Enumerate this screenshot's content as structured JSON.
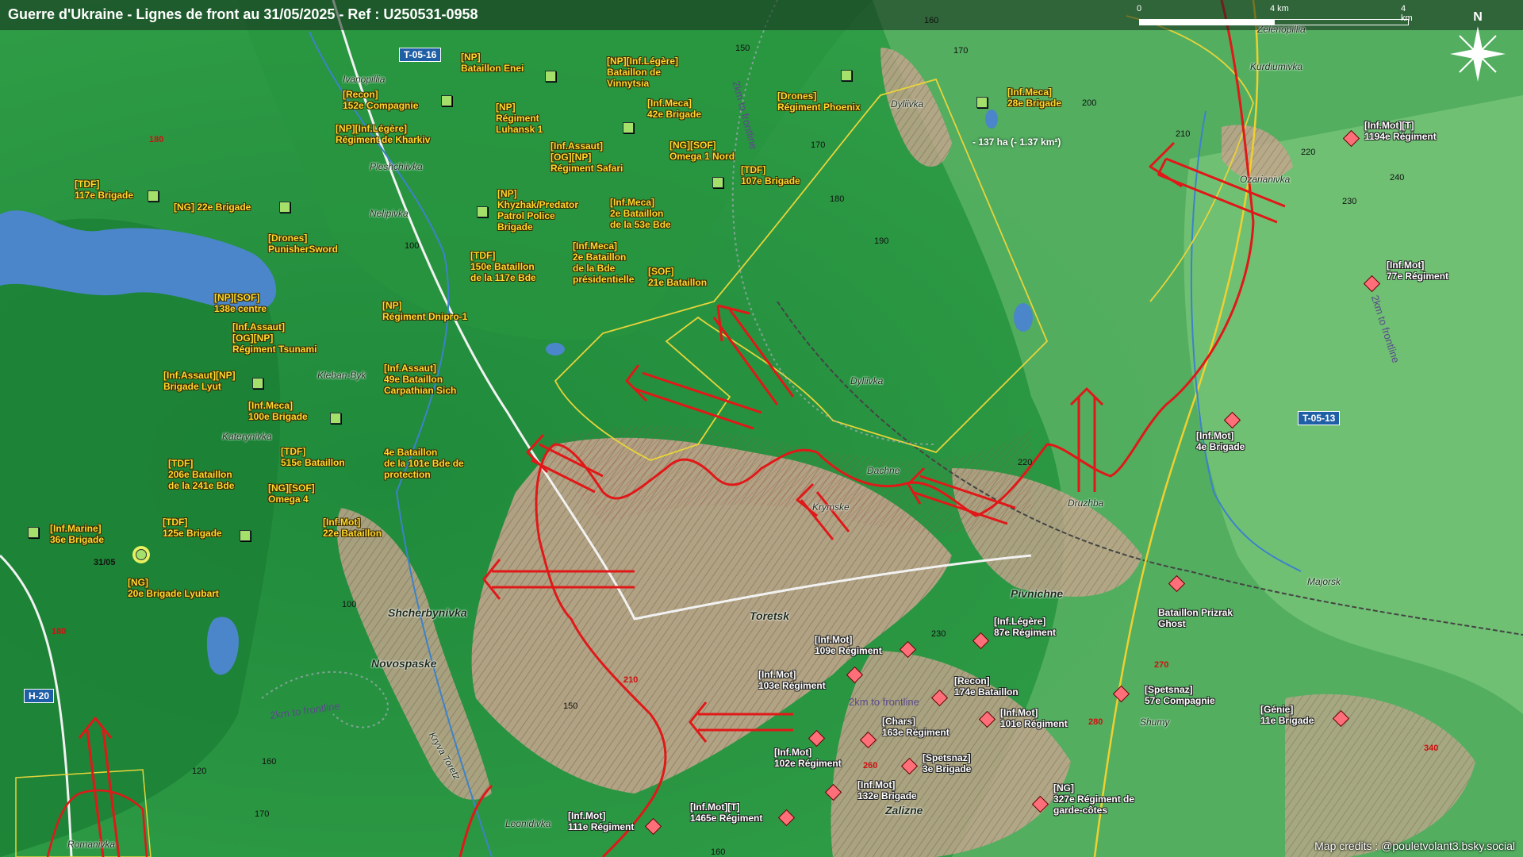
{
  "title": "Guerre d'Ukraine - Lignes de front au 31/05/2025 - Ref : U250531-0958",
  "scale": {
    "t0": "0",
    "t1": "2",
    "t2": "4 km"
  },
  "north_label": "N",
  "credits": "Map credits : @pouletvolant3.bsky.social",
  "area_note": "- 137 ha (- 1.37 km²)",
  "date_mark": "31/05",
  "colors": {
    "front": "#e01818",
    "ua_unit_text": "#ffd92e",
    "ru_unit_fill": "#ff6f7a",
    "road_badge": "#1f5fa6"
  },
  "roads": [
    "T-05-16",
    "T-05-13",
    "H-20"
  ],
  "route_labels": [
    "2km to frontline",
    "2km to frontline",
    "2km to frontline",
    "2km to frontline"
  ],
  "elevations": [
    "150",
    "160",
    "170",
    "180",
    "190",
    "200",
    "210",
    "220",
    "230",
    "240",
    "180",
    "180",
    "150",
    "160",
    "170",
    "160",
    "120",
    "230",
    "270",
    "280",
    "340",
    "260",
    "210",
    "100",
    "100",
    "220",
    "210",
    "160",
    "170",
    "180"
  ],
  "places": [
    {
      "name": "Ivanopillia",
      "big": false
    },
    {
      "name": "Pleshchiivka",
      "big": false
    },
    {
      "name": "Nelipivka",
      "big": false
    },
    {
      "name": "Kleban-Byk",
      "big": false
    },
    {
      "name": "Katerynivka",
      "big": false
    },
    {
      "name": "Shcherbynivka",
      "big": true
    },
    {
      "name": "Novospaske",
      "big": true
    },
    {
      "name": "Romanivka",
      "big": false
    },
    {
      "name": "Leonidivka",
      "big": false
    },
    {
      "name": "Toretsk",
      "big": true
    },
    {
      "name": "Krymske",
      "big": false
    },
    {
      "name": "Dachne",
      "big": false
    },
    {
      "name": "Dyliivka",
      "big": false
    },
    {
      "name": "Dyliivka",
      "big": false
    },
    {
      "name": "Druzhba",
      "big": false
    },
    {
      "name": "Pivnichne",
      "big": true
    },
    {
      "name": "Zalizne",
      "big": true
    },
    {
      "name": "Shumy",
      "big": false
    },
    {
      "name": "Majorsk",
      "big": false
    },
    {
      "name": "Ozarianivka",
      "big": false
    },
    {
      "name": "Kurdiumivka",
      "big": false
    },
    {
      "name": "Zelenopillia",
      "big": false
    },
    {
      "name": "Kryva Toretz",
      "big": false
    }
  ],
  "ua_units": [
    "[NP]\nBataillon Enei",
    "[NP][Inf.Légère]\nBataillon de\nVinnytsia",
    "[Recon]\n152e Compagnie",
    "[NP]\nRégiment\nLuhansk 1",
    "[Inf.Meca]\n42e Brigade",
    "[NP][Inf.Légère]\nRégiment de Kharkiv",
    "[Inf.Assaut]\n[OG][NP]\nRégiment Safari",
    "[NG][SOF]\nOmega 1 Nord",
    "[TDF]\n107e Brigade",
    "[TDF]\n117e Brigade",
    "[NG] 22e Brigade",
    "[NP]\nKhyzhak/Predator\nPatrol Police\nBrigade",
    "[Inf.Meca]\n2e Bataillon\nde la 53e Bde",
    "[Drones]\nPunisherSword",
    "[TDF]\n150e Bataillon\nde la 117e Bde",
    "[Inf.Meca]\n2e Bataillon\nde la Bde\nprésidentielle",
    "[SOF]\n21e Bataillon",
    "[NP][SOF]\n138e centre",
    "[NP]\nRégiment Dnipro-1",
    "[Inf.Assaut]\n[OG][NP]\nRégiment Tsunami",
    "[Inf.Assaut]\n49e Bataillon\nCarpathian Sich",
    "[Inf.Assaut][NP]\nBrigade Lyut",
    "[Inf.Meca]\n100e Brigade",
    "[TDF]\n206e Bataillon\nde la 241e Bde",
    "[TDF]\n515e Bataillon",
    "4e Bataillon\nde la 101e Bde de\nprotection",
    "[NG][SOF]\nOmega 4",
    "[Inf.Marine]\n36e Brigade",
    "[TDF]\n125e Brigade",
    "[Inf.Mot]\n22e Bataillon",
    "[NG]\n20e Brigade Lyubart",
    "[Drones]\nRégiment Phoenix",
    "[Inf.Meca]\n28e Brigade"
  ],
  "ru_units": [
    "[Inf.Mot][T]\n1194e Régiment",
    "[Inf.Mot]\n77e Régiment",
    "[Inf.Mot]\n4e Brigade",
    "Bataillon Prizrak\nGhost",
    "[Inf.Légère]\n87e Régiment",
    "[Inf.Mot]\n109e Régiment",
    "[Inf.Mot]\n103e Régiment",
    "[Recon]\n174e Bataillon",
    "[Spetsnaz]\n57e Compagnie",
    "[Inf.Mot]\n101e Régiment",
    "[Chars]\n163e Régiment",
    "[Génie]\n11e Brigade",
    "[Inf.Mot]\n102e Régiment",
    "[Spetsnaz]\n3e Brigade",
    "[Inf.Mot]\n132e Brigade",
    "[NG]\n327e Régiment de\ngarde-côtes",
    "[Inf.Mot]\n111e Régiment",
    "[Inf.Mot][T]\n1465e Régiment"
  ]
}
